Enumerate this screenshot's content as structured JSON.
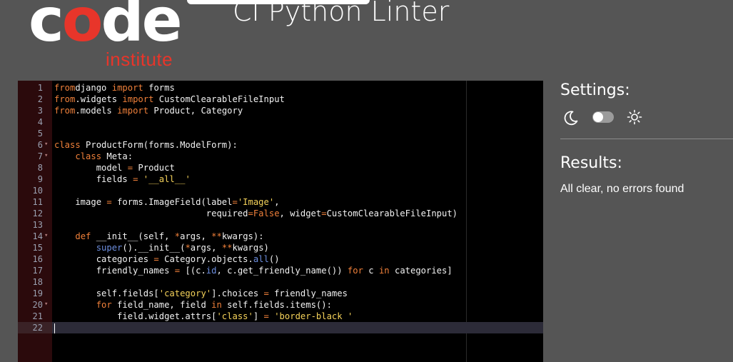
{
  "header": {
    "logo_word_start": "c",
    "logo_word_o": "o",
    "logo_word_end": "de",
    "logo_sub": "institute",
    "title": "CI Python Linter"
  },
  "editor": {
    "active_line": 22,
    "lines": [
      {
        "n": "1",
        "fold": false,
        "tokens": [
          [
            "kw",
            "from"
          ],
          [
            "",
            "django "
          ],
          [
            "kw",
            "import"
          ],
          [
            "",
            " forms"
          ]
        ]
      },
      {
        "n": "2",
        "fold": false,
        "tokens": [
          [
            "kw",
            "from"
          ],
          [
            "",
            ".widgets "
          ],
          [
            "kw",
            "import"
          ],
          [
            "",
            " CustomClearableFileInput"
          ]
        ]
      },
      {
        "n": "3",
        "fold": false,
        "tokens": [
          [
            "kw",
            "from"
          ],
          [
            "",
            ".models "
          ],
          [
            "kw",
            "import"
          ],
          [
            "",
            " Product, Category"
          ]
        ]
      },
      {
        "n": "4",
        "fold": false,
        "tokens": []
      },
      {
        "n": "5",
        "fold": false,
        "tokens": []
      },
      {
        "n": "6",
        "fold": true,
        "tokens": [
          [
            "kw",
            "class"
          ],
          [
            "",
            " ProductForm(forms.ModelForm):"
          ]
        ]
      },
      {
        "n": "7",
        "fold": true,
        "tokens": [
          [
            "",
            "    "
          ],
          [
            "kw",
            "class"
          ],
          [
            "",
            " Meta:"
          ]
        ]
      },
      {
        "n": "8",
        "fold": false,
        "tokens": [
          [
            "",
            "        model "
          ],
          [
            "op",
            "="
          ],
          [
            "",
            " Product"
          ]
        ]
      },
      {
        "n": "9",
        "fold": false,
        "tokens": [
          [
            "",
            "        fields "
          ],
          [
            "op",
            "="
          ],
          [
            "",
            " "
          ],
          [
            "str",
            "'__all__'"
          ]
        ]
      },
      {
        "n": "10",
        "fold": false,
        "tokens": []
      },
      {
        "n": "11",
        "fold": false,
        "tokens": [
          [
            "",
            "    image "
          ],
          [
            "op",
            "="
          ],
          [
            "",
            " forms.ImageField(label"
          ],
          [
            "op",
            "="
          ],
          [
            "str",
            "'Image'"
          ],
          [
            "",
            ","
          ]
        ]
      },
      {
        "n": "12",
        "fold": false,
        "tokens": [
          [
            "",
            "                             required"
          ],
          [
            "op",
            "="
          ],
          [
            "kw",
            "False"
          ],
          [
            "",
            ", widget"
          ],
          [
            "op",
            "="
          ],
          [
            "",
            "CustomClearableFileInput)"
          ]
        ]
      },
      {
        "n": "13",
        "fold": false,
        "tokens": []
      },
      {
        "n": "14",
        "fold": true,
        "tokens": [
          [
            "",
            "    "
          ],
          [
            "kw",
            "def"
          ],
          [
            "",
            " __init__(self, "
          ],
          [
            "op",
            "*"
          ],
          [
            "",
            "args, "
          ],
          [
            "op",
            "**"
          ],
          [
            "",
            "kwargs):"
          ]
        ]
      },
      {
        "n": "15",
        "fold": false,
        "tokens": [
          [
            "",
            "        "
          ],
          [
            "blt",
            "super"
          ],
          [
            "",
            "().__init__("
          ],
          [
            "op",
            "*"
          ],
          [
            "",
            "args, "
          ],
          [
            "op",
            "**"
          ],
          [
            "",
            "kwargs)"
          ]
        ]
      },
      {
        "n": "16",
        "fold": false,
        "tokens": [
          [
            "",
            "        categories "
          ],
          [
            "op",
            "="
          ],
          [
            "",
            " Category.objects."
          ],
          [
            "blt",
            "all"
          ],
          [
            "",
            "()"
          ]
        ]
      },
      {
        "n": "17",
        "fold": false,
        "tokens": [
          [
            "",
            "        friendly_names "
          ],
          [
            "op",
            "="
          ],
          [
            "",
            " [(c."
          ],
          [
            "blt",
            "id"
          ],
          [
            "",
            ", c.get_friendly_name()) "
          ],
          [
            "kw",
            "for"
          ],
          [
            "",
            " c "
          ],
          [
            "kw",
            "in"
          ],
          [
            "",
            " categories]"
          ]
        ]
      },
      {
        "n": "18",
        "fold": false,
        "tokens": []
      },
      {
        "n": "19",
        "fold": false,
        "tokens": [
          [
            "",
            "        self.fields["
          ],
          [
            "str",
            "'category'"
          ],
          [
            "",
            "].choices "
          ],
          [
            "op",
            "="
          ],
          [
            "",
            " friendly_names"
          ]
        ]
      },
      {
        "n": "20",
        "fold": true,
        "tokens": [
          [
            "",
            "        "
          ],
          [
            "kw",
            "for"
          ],
          [
            "",
            " field_name, field "
          ],
          [
            "kw",
            "in"
          ],
          [
            "",
            " self.fields.items():"
          ]
        ]
      },
      {
        "n": "21",
        "fold": false,
        "tokens": [
          [
            "",
            "            field.widget.attrs["
          ],
          [
            "str",
            "'class'"
          ],
          [
            "",
            "] "
          ],
          [
            "op",
            "="
          ],
          [
            "",
            " "
          ],
          [
            "str",
            "'border-black '"
          ]
        ]
      },
      {
        "n": "22",
        "fold": false,
        "tokens": []
      }
    ]
  },
  "settings": {
    "title": "Settings:",
    "dark_icon": "moon-icon",
    "light_icon": "sun-icon",
    "theme_toggle_on": false
  },
  "results": {
    "title": "Results:",
    "message": "All clear, no errors found"
  },
  "colors": {
    "background": "#555555",
    "editor_bg": "#000000",
    "gutter_bg": "#2b0a0c",
    "brand_red": "#e8352a",
    "keyword": "#f0803a",
    "string": "#f5d25a",
    "builtin": "#6d8fe0"
  }
}
